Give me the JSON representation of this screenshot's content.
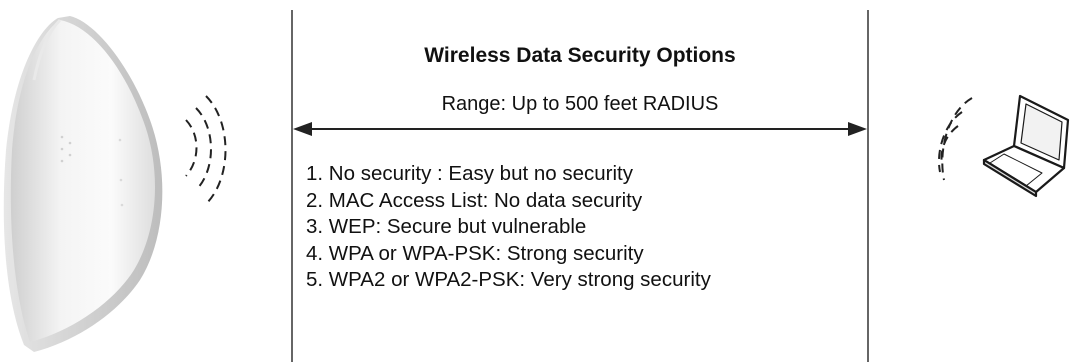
{
  "title": "Wireless Data Security Options",
  "range": "Range:  Up to 500 feet RADIUS",
  "options": [
    "1. No  security : Easy but no security",
    "2. MAC Access List: No data security",
    "3. WEP: Secure but vulnerable",
    "4. WPA or WPA-PSK: Strong security",
    "5. WPA2 or WPA2-PSK: Very strong security"
  ],
  "icons": {
    "access_point": "access-point-icon",
    "laptop": "laptop-icon",
    "signal": "wifi-signal-icon"
  }
}
